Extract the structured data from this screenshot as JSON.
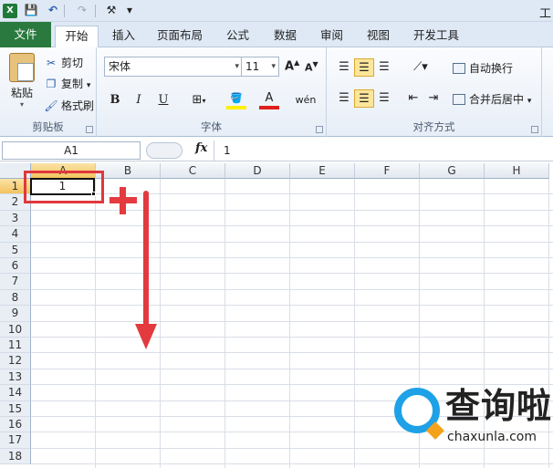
{
  "app": {
    "icon_letter": "X",
    "title_fragment": "工"
  },
  "quick_access": {
    "save_icon": "💾",
    "undo_icon": "↶",
    "redo_icon": "↷",
    "customize_icon": "⚒",
    "more_icon": "▾"
  },
  "tabs": [
    {
      "label": "文件"
    },
    {
      "label": "开始"
    },
    {
      "label": "插入"
    },
    {
      "label": "页面布局"
    },
    {
      "label": "公式"
    },
    {
      "label": "数据"
    },
    {
      "label": "审阅"
    },
    {
      "label": "视图"
    },
    {
      "label": "开发工具"
    }
  ],
  "ribbon": {
    "clipboard": {
      "label": "剪贴板",
      "paste": "粘贴",
      "cut": "剪切",
      "copy": "复制",
      "format_painter": "格式刷"
    },
    "font": {
      "label": "字体",
      "font_name": "宋体",
      "font_size": "11",
      "grow": "A",
      "shrink": "A",
      "bold": "B",
      "italic": "I",
      "underline": "U",
      "fill_icon": "🪣",
      "font_color_letter": "A",
      "phonetic": "wén"
    },
    "alignment": {
      "label": "对齐方式",
      "wrap_text": "自动换行",
      "merge_center": "合并后居中"
    }
  },
  "formula_bar": {
    "name_box": "A1",
    "fx": "fx",
    "value": "1"
  },
  "sheet": {
    "columns": [
      "A",
      "B",
      "C",
      "D",
      "E",
      "F",
      "G",
      "H"
    ],
    "rows": [
      "1",
      "2",
      "3",
      "4",
      "5",
      "6",
      "7",
      "8",
      "9",
      "10",
      "11",
      "12",
      "13",
      "14",
      "15",
      "16",
      "17",
      "18"
    ],
    "active_cell": {
      "ref": "A1",
      "value": "1"
    }
  },
  "watermark": {
    "title": "查询啦",
    "url": "chaxunla.com"
  },
  "colors": {
    "file_tab": "#2a7a3f",
    "annotation_red": "#e23a3e",
    "selected_header": "#f2c35e",
    "watermark_blue": "#1ea1e6"
  }
}
